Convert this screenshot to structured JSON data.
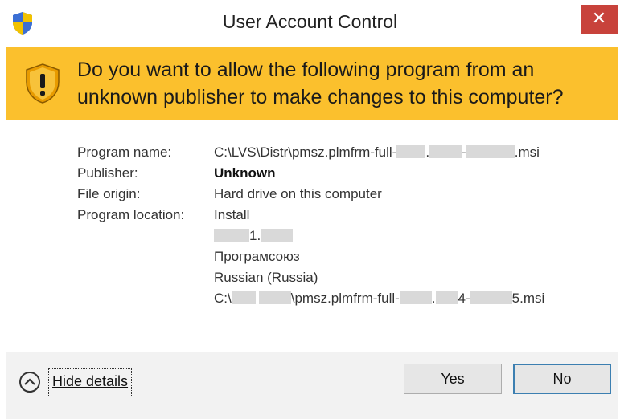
{
  "window": {
    "title": "User Account Control",
    "close_label": "✕"
  },
  "banner": {
    "line1": "Do you want to allow the following program from an",
    "line2": "unknown publisher to make changes to this computer?"
  },
  "details": {
    "program_name_label": "Program name:",
    "program_name_prefix": "C:\\LVS\\Distr\\pmsz.plmfrm-full-",
    "program_name_mid1": ".",
    "program_name_mid2": "-",
    "program_name_suffix": ".msi",
    "publisher_label": "Publisher:",
    "publisher_value": "Unknown",
    "file_origin_label": "File origin:",
    "file_origin_value": "Hard drive on this computer",
    "program_location_label": "Program location:",
    "location_line1": "Install",
    "location_line2_suffix": "1.",
    "location_line3": "Програмсоюз",
    "location_line4": "Russian (Russia)",
    "location_line5_prefix": "C:\\",
    "location_line5_mid": "\\pmsz.plmfrm-full-",
    "location_line5_mid2": ".",
    "location_line5_mid3": "4-",
    "location_line5_suffix": "5.msi"
  },
  "footer": {
    "hide_details_label": "Hide details",
    "yes_label": "Yes",
    "no_label": "No"
  }
}
